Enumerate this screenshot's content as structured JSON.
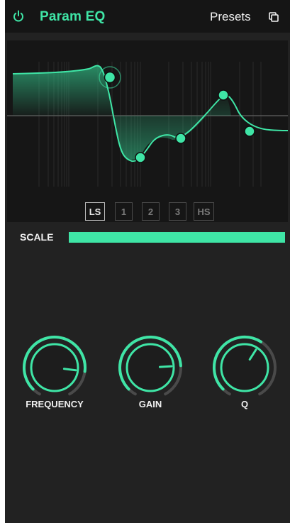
{
  "header": {
    "title": "Param EQ",
    "presets_label": "Presets",
    "power_icon": "power-icon",
    "copy_icon": "copy-icon"
  },
  "colors": {
    "accent": "#3fe5a6",
    "panel_bg": "#222222",
    "header_bg": "#151515",
    "graph_bg": "#161616"
  },
  "bands": [
    {
      "label": "LS",
      "active": true
    },
    {
      "label": "1",
      "active": false
    },
    {
      "label": "2",
      "active": false
    },
    {
      "label": "3",
      "active": false
    },
    {
      "label": "HS",
      "active": false
    }
  ],
  "scale": {
    "label": "SCALE",
    "value": 1.0
  },
  "knobs": [
    {
      "label": "FREQUENCY",
      "value": 0.86
    },
    {
      "label": "GAIN",
      "value": 0.82
    },
    {
      "label": "Q",
      "value": 0.62
    }
  ]
}
